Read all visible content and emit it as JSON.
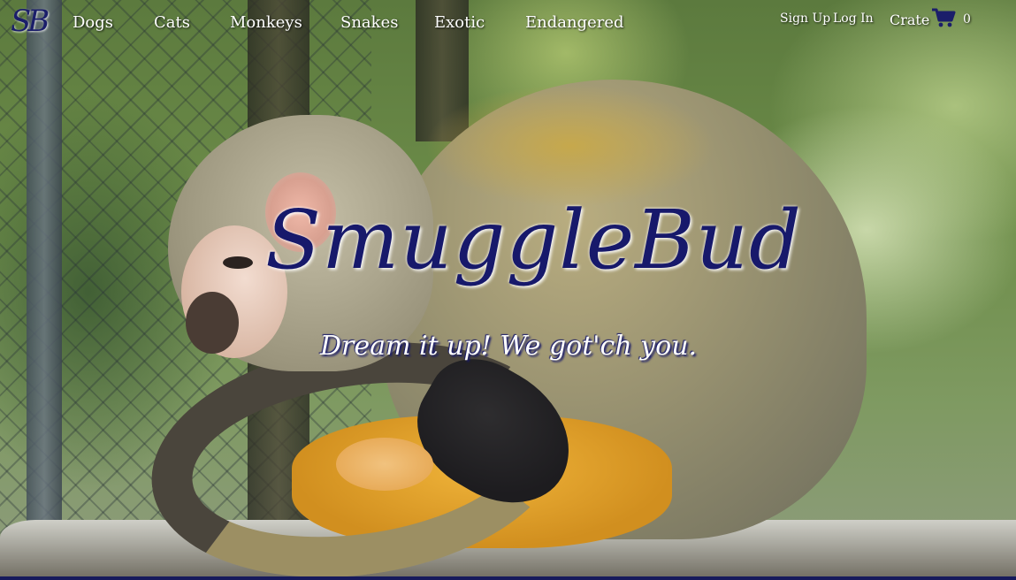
{
  "brand": {
    "logo_text": "SB",
    "title": "SmuggleBud",
    "tagline": "Dream it up! We got'ch you."
  },
  "nav": {
    "links": [
      "Dogs",
      "Cats",
      "Monkeys",
      "Snakes",
      "Exotic",
      "Endangered"
    ],
    "sign_up": "Sign Up",
    "log_in": "Log In",
    "crate": "Crate",
    "cart_count": "0",
    "cart_icon": "shopping-cart-icon"
  },
  "colors": {
    "brand_navy": "#17196b",
    "nav_text": "#ffffff"
  }
}
